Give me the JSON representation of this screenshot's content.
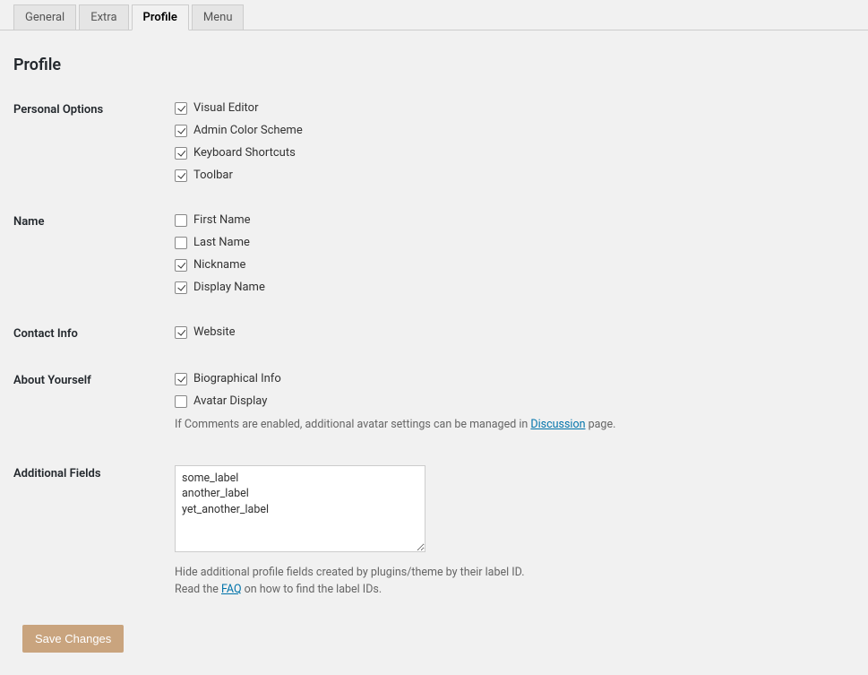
{
  "tabs": {
    "general": "General",
    "extra": "Extra",
    "profile": "Profile",
    "menu": "Menu"
  },
  "page_title": "Profile",
  "sections": {
    "personal_options": {
      "label": "Personal Options",
      "items": {
        "visual_editor": "Visual Editor",
        "admin_color_scheme": "Admin Color Scheme",
        "keyboard_shortcuts": "Keyboard Shortcuts",
        "toolbar": "Toolbar"
      }
    },
    "name": {
      "label": "Name",
      "items": {
        "first_name": "First Name",
        "last_name": "Last Name",
        "nickname": "Nickname",
        "display_name": "Display Name"
      }
    },
    "contact_info": {
      "label": "Contact Info",
      "items": {
        "website": "Website"
      }
    },
    "about_yourself": {
      "label": "About Yourself",
      "items": {
        "biographical_info": "Biographical Info",
        "avatar_display": "Avatar Display"
      },
      "desc_before": "If Comments are enabled, additional avatar settings can be managed in ",
      "desc_link": "Discussion",
      "desc_after": " page."
    },
    "additional_fields": {
      "label": "Additional Fields",
      "value": "some_label\nanother_label\nyet_another_label",
      "desc_line1": "Hide additional profile fields created by plugins/theme by their label ID.",
      "desc_line2_before": "Read the ",
      "desc_line2_link": "FAQ",
      "desc_line2_after": " on how to find the label IDs."
    }
  },
  "save_button": "Save Changes"
}
